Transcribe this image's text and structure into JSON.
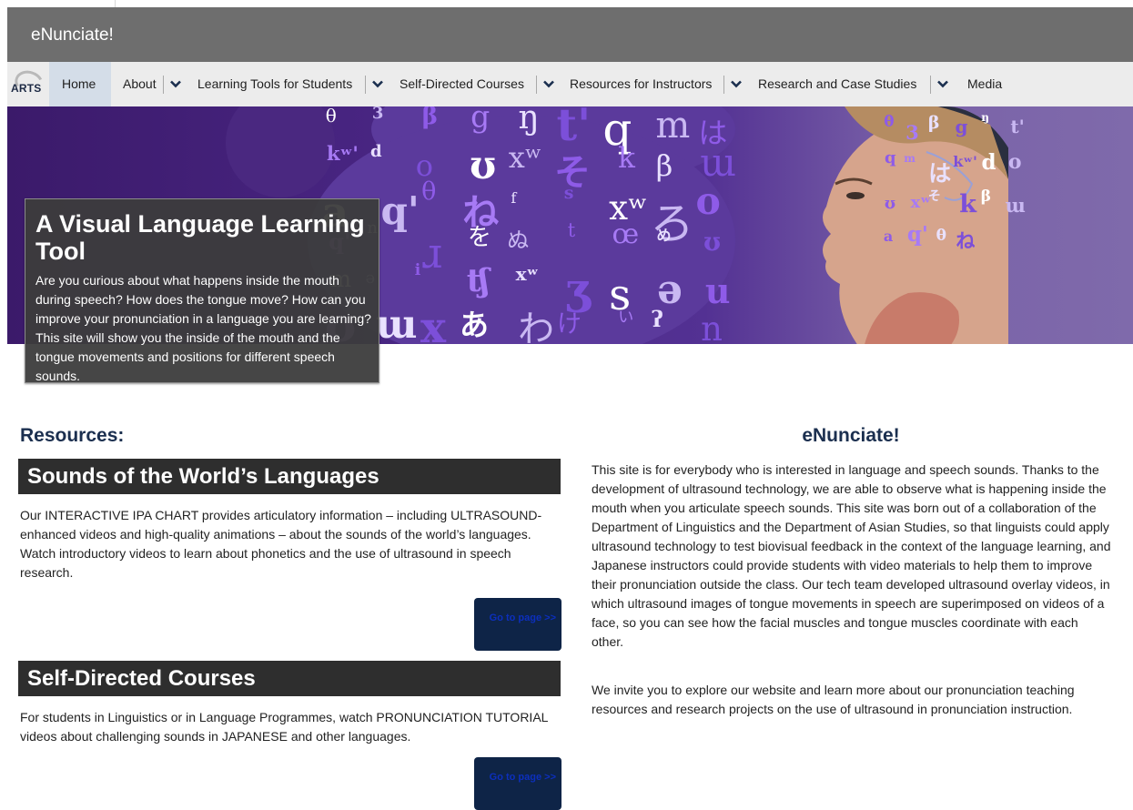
{
  "site": {
    "title": "eNunciate!"
  },
  "nav": {
    "logo_text": "ARTS",
    "items": [
      {
        "label": "Home",
        "has_dropdown": false,
        "active": true
      },
      {
        "label": "About",
        "has_dropdown": true
      },
      {
        "label": "Learning Tools for Students",
        "has_dropdown": true
      },
      {
        "label": "Self-Directed Courses",
        "has_dropdown": true
      },
      {
        "label": "Resources for Instructors",
        "has_dropdown": true
      },
      {
        "label": "Research and Case Studies",
        "has_dropdown": true
      },
      {
        "label": "Media",
        "has_dropdown": false
      }
    ]
  },
  "hero": {
    "title": "A Visual Language Learning Tool",
    "text": "Are you curious about what happens inside the mouth during speech? How does the tongue move? How can you improve your pronunciation in a language you are learning? This site will show you the inside of the mouth and the tongue movements and positions for different speech sounds.",
    "glyphs": [
      "θ",
      "3",
      "β",
      "g",
      "ŋ",
      "t'",
      "q",
      "m",
      "は",
      "kʷ'",
      "d",
      "o",
      "ʊ",
      "xʷ",
      "そ",
      "k",
      "β",
      "ɯ",
      "a",
      "q'",
      "θ",
      "ね",
      "f",
      "s",
      "xʷ",
      "ろ",
      "o",
      "q'",
      "n",
      "ɹ",
      "を",
      "ぬ",
      "t",
      "œ",
      "め",
      "ʊ",
      "m",
      "ə",
      "i",
      "ʧ",
      "xʷ",
      "ʒ",
      "s",
      "ə",
      "u",
      "ʊ",
      "ɯ",
      "x",
      "あ",
      "わ",
      "け",
      "い",
      "ʔ",
      "n"
    ]
  },
  "resources": {
    "heading": "Resources:",
    "sections": [
      {
        "title": "Sounds of the World’s Languages",
        "text": "Our INTERACTIVE IPA CHART provides articulatory information – including ULTRASOUND-enhanced videos and high-quality animations – about the sounds of the world’s languages. Watch introductory videos to learn about phonetics and the use of ultrasound in speech research.",
        "button": "Go to page >>"
      },
      {
        "title": "Self-Directed Courses",
        "text": "For students in Linguistics or in Language Programmes, watch PRONUNCIATION TUTORIAL videos about challenging sounds in JAPANESE and other languages.",
        "button": "Go to page >>"
      }
    ]
  },
  "about": {
    "heading": "eNunciate!",
    "paragraphs": [
      "This site is for everybody who is interested in language and speech sounds. Thanks to the development of ultrasound technology, we are able to observe what is happening inside the mouth when you articulate speech sounds. This site was born out of a collaboration of the Department of Linguistics and the Department of Asian Studies, so that linguists could apply ultrasound technology to test biovisual feedback in the context of the language learning, and Japanese instructors could provide students with video materials to help them to improve their pronunciation outside the class. Our tech team developed ultrasound overlay videos, in which ultrasound images of tongue movements in speech are superimposed on videos of a face, so you can see how the facial muscles and tongue muscles coordinate with each other.",
      "We invite you to explore our website and learn more about our pronunciation teaching resources and research projects on the use of ultrasound in pronunciation instruction."
    ]
  },
  "colors": {
    "title_bar": "#6e6e6e",
    "nav_bar": "#ececec",
    "heading_navy": "#1b2f4f",
    "section_bar": "#2e2e2e",
    "button_bg": "#0e2447",
    "button_text": "#0c2fbd"
  }
}
